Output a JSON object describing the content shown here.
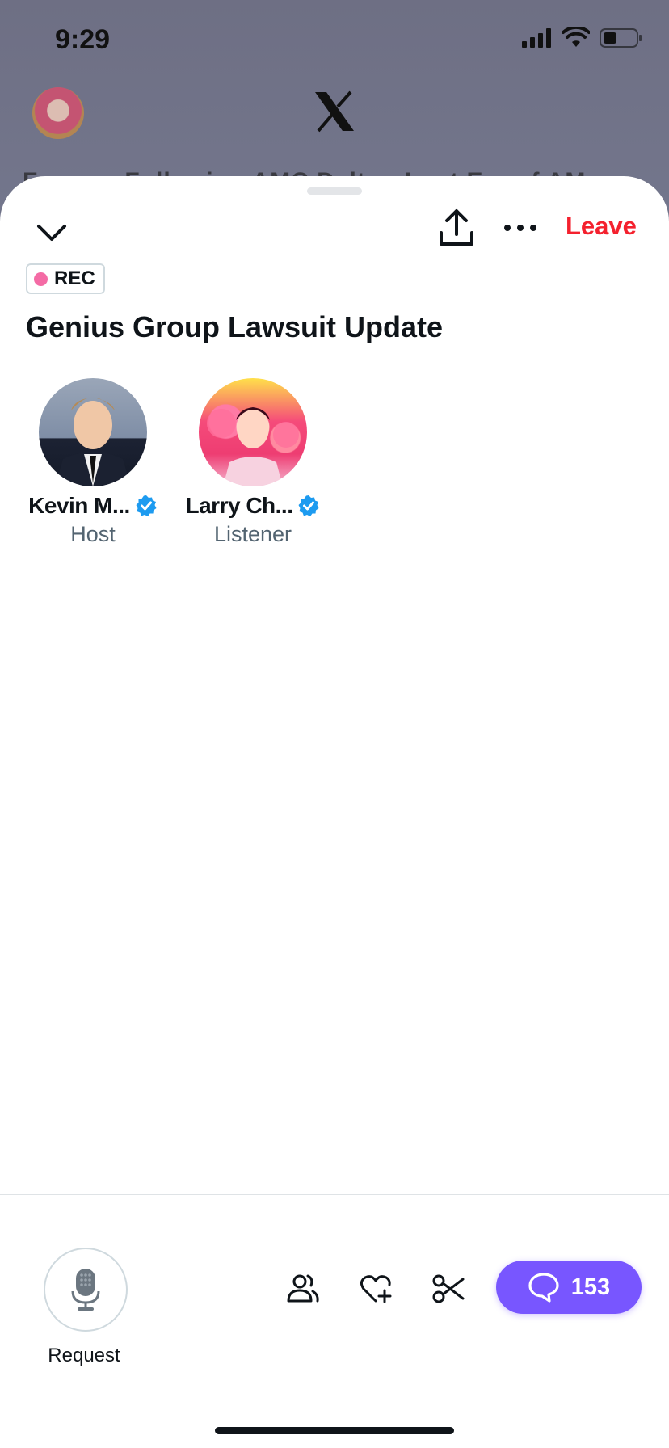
{
  "status_bar": {
    "time": "9:29"
  },
  "background": {
    "tabs_peek": "For you   Following   AMC   Dalton   Lost Era of AM"
  },
  "space": {
    "recording_badge": "REC",
    "title": "Genius Group Lawsuit Update",
    "leave_label": "Leave",
    "participants": [
      {
        "name": "Kevin M...",
        "role": "Host",
        "verified": true
      },
      {
        "name": "Larry Ch...",
        "role": "Listener",
        "verified": true
      }
    ]
  },
  "bottom_bar": {
    "request_label": "Request",
    "comments_count": "153"
  },
  "colors": {
    "accent": "#7856ff",
    "leave": "#f4212e",
    "verified": "#1d9bf0",
    "rec_dot": "#f46ba5"
  },
  "icons": [
    "chevron-down-icon",
    "share-icon",
    "more-icon",
    "microphone-icon",
    "people-icon",
    "heart-plus-icon",
    "scissors-icon",
    "comment-icon",
    "verified-icon"
  ]
}
